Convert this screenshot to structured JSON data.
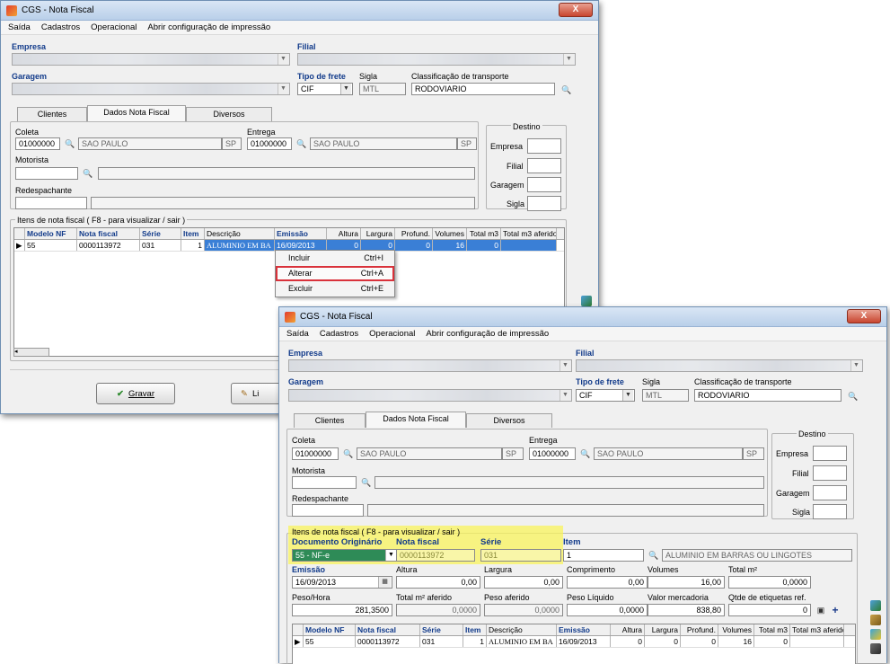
{
  "windows": {
    "title": "CGS - Nota Fiscal",
    "close": "X"
  },
  "menu": [
    "Saída",
    "Cadastros",
    "Operacional",
    "Abrir configuração de impressão"
  ],
  "labels": {
    "empresa": "Empresa",
    "filial": "Filial",
    "garagem": "Garagem",
    "tipo_frete": "Tipo de frete",
    "sigla": "Sigla",
    "classificacao": "Classificação de transporte",
    "coleta": "Coleta",
    "entrega": "Entrega",
    "motorista": "Motorista",
    "redespachante": "Redespachante",
    "destino": "Destino",
    "empresa_d": "Empresa",
    "filial_d": "Filial",
    "garagem_d": "Garagem",
    "sigla_d": "Sigla"
  },
  "fields": {
    "tipo_frete": "CIF",
    "sigla": "MTL",
    "classificacao": "RODOVIARIO",
    "coleta_cep": "01000000",
    "coleta_cidade": "SAO PAULO",
    "coleta_uf": "SP",
    "entrega_cep": "01000000",
    "entrega_cidade": "SAO PAULO",
    "entrega_uf": "SP"
  },
  "tabs": [
    "Clientes",
    "Dados Nota Fiscal",
    "Diversos"
  ],
  "group_itens": "Itens de nota fiscal ( F8 - para visualizar / sair )",
  "grid": {
    "headers": [
      "Modelo NF",
      "Nota fiscal",
      "Série",
      "Item",
      "Descrição",
      "Emissão",
      "Altura",
      "Largura",
      "Profund.",
      "Volumes",
      "Total m3",
      "Total m3 aferido"
    ],
    "row": {
      "modelo": "55",
      "nota": "0000113972",
      "serie": "031",
      "item": "1",
      "descricao": "ALUMINIO EM BA",
      "emissao": "16/09/2013",
      "altura": "0",
      "largura": "0",
      "profund": "0",
      "volumes": "16",
      "total": "0"
    }
  },
  "context_menu": [
    {
      "label": "Incluir",
      "key": "Ctrl+I"
    },
    {
      "label": "Alterar",
      "key": "Ctrl+A"
    },
    {
      "label": "Excluir",
      "key": "Ctrl+E"
    }
  ],
  "buttons": {
    "gravar": "Gravar",
    "limpar": "Li"
  },
  "detail": {
    "doc_label": "Documento Originário",
    "doc_value": "55 - NF-e",
    "nf_label": "Nota fiscal",
    "nf_value": "0000113972",
    "serie_label": "Série",
    "serie_value": "031",
    "item_label": "Item",
    "item_value": "1",
    "item_desc": "ALUMINIO EM BARRAS OU LINGOTES",
    "emissao_label": "Emissão",
    "emissao_value": "16/09/2013",
    "altura_label": "Altura",
    "altura_value": "0,00",
    "largura_label": "Largura",
    "largura_value": "0,00",
    "comprimento_label": "Comprimento",
    "comprimento_value": "0,00",
    "volumes_label": "Volumes",
    "volumes_value": "16,00",
    "totalm2_label": "Total m²",
    "totalm2_value": "0,0000",
    "peso_label": "Peso/Hora",
    "peso_value": "281,3500",
    "totalaf_label": "Total m² aferido",
    "totalaf_value": "0,0000",
    "pesoaf_label": "Peso aferido",
    "pesoaf_value": "0,0000",
    "pesoliq_label": "Peso Líquido",
    "pesoliq_value": "0,0000",
    "valor_label": "Valor mercadoria",
    "valor_value": "838,80",
    "qtde_label": "Qtde de etiquetas ref.",
    "qtde_value": "0"
  }
}
